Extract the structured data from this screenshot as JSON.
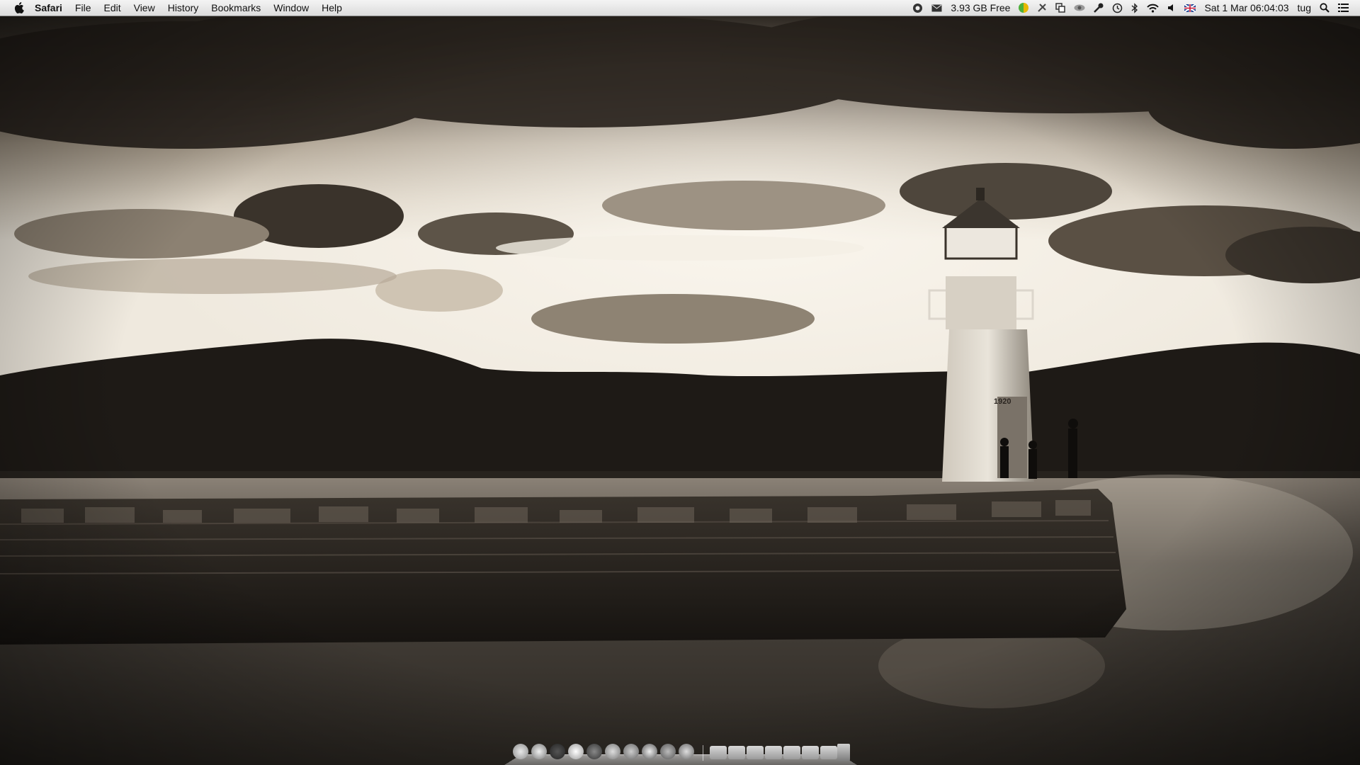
{
  "menubar": {
    "app_name": "Safari",
    "menus": [
      "File",
      "Edit",
      "View",
      "History",
      "Bookmarks",
      "Window",
      "Help"
    ],
    "disk_free": "3.93 GB Free",
    "clock": "Sat 1 Mar  06:04:03",
    "user": "tug",
    "status_icons": [
      "tor-icon",
      "mail-icon",
      "disk-icon",
      "color-icon",
      "script-icon",
      "copy-icon",
      "eye-icon",
      "wrench-icon",
      "time-machine-icon",
      "bluetooth-icon",
      "wifi-icon",
      "volume-icon",
      "flag-uk-icon",
      "spotlight-icon",
      "list-icon"
    ]
  },
  "wallpaper": {
    "tone_light": "#d9d0c2",
    "tone_dark": "#1b1814",
    "lighthouse_year": "1920"
  },
  "dock": {
    "apps": [
      "finder-icon",
      "safari-icon",
      "itunes-icon",
      "windows-icon",
      "facetime-icon",
      "preferences-icon",
      "settings-icon",
      "gear-icon",
      "compass-icon",
      "utilities-icon"
    ],
    "folders": [
      "folder-icon",
      "folder-icon",
      "folder-icon",
      "folder-icon",
      "folder-icon",
      "folder-icon",
      "folder-icon"
    ],
    "trash": "trash-icon"
  }
}
